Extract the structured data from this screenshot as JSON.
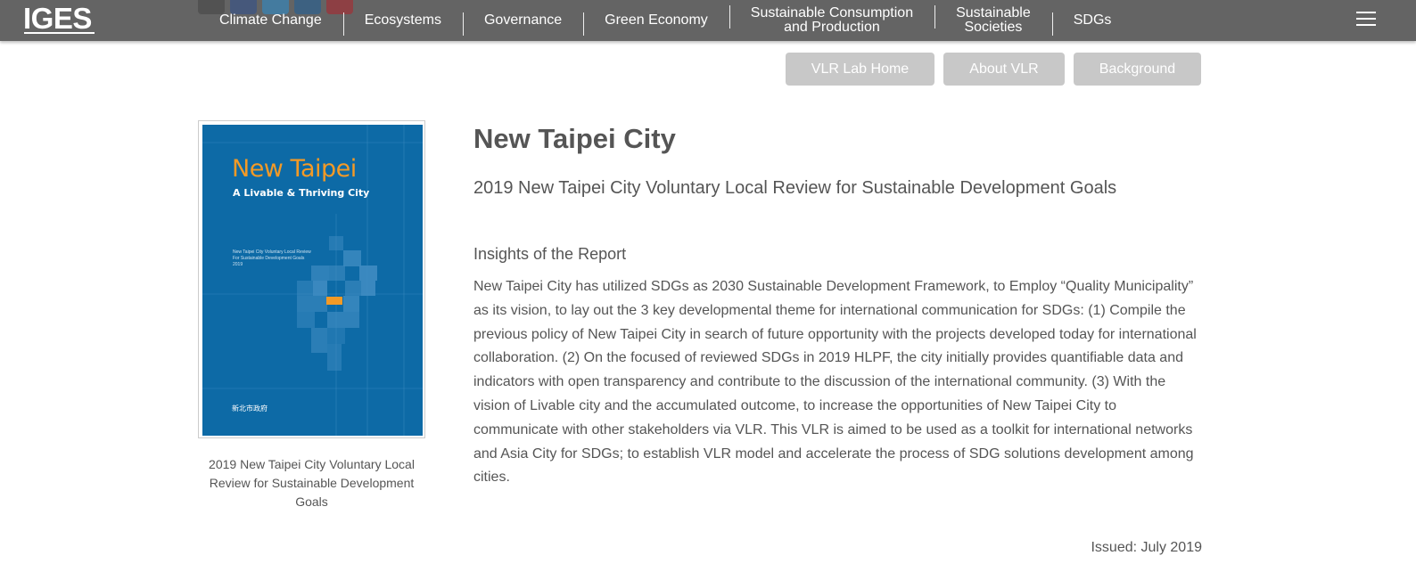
{
  "header": {
    "logo": "IGES",
    "nav": [
      {
        "label_line1": "Climate Change",
        "label_line2": ""
      },
      {
        "label_line1": "Ecosystems",
        "label_line2": ""
      },
      {
        "label_line1": "Governance",
        "label_line2": ""
      },
      {
        "label_line1": "Green Economy",
        "label_line2": ""
      },
      {
        "label_line1": "Sustainable Consumption",
        "label_line2": "and Production"
      },
      {
        "label_line1": "Sustainable",
        "label_line2": "Societies"
      },
      {
        "label_line1": "SDGs",
        "label_line2": ""
      }
    ],
    "menu_icon": "hamburger-icon",
    "social_icons": [
      "email-icon",
      "facebook-icon",
      "twitter-icon",
      "linkedin-icon",
      "pinterest-icon"
    ]
  },
  "subnav": {
    "vlr_home": "VLR Lab Home",
    "about_vlr": "About VLR",
    "background": "Background"
  },
  "cover": {
    "title": "New Taipei",
    "subtitle": "A Livable & Thriving City",
    "small_text": "New Taipei City Voluntary Local Review For Sustainable Development Goals 2019",
    "caption": "2019 New Taipei City Voluntary Local Review for Sustainable Development Goals"
  },
  "main": {
    "title": "New Taipei City",
    "subtitle": "2019 New Taipei City Voluntary Local Review for Sustainable Development Goals",
    "section_heading": "Insights of the Report",
    "body": "New Taipei City has utilized SDGs as 2030 Sustainable Development Framework, to Employ “Quality Municipality” as its vision, to lay out the 3 key developmental theme for international communication for SDGs: (1) Compile the previous policy of New Taipei City in search of future opportunity with the projects developed today for international collaboration. (2) On the focused of reviewed SDGs in 2019 HLPF, the city initially provides quantifiable data and indicators with open transparency and contribute to the discussion of the international community. (3) With the vision of Livable city and the accumulated outcome, to increase the opportunities of New Taipei City to communicate with other stakeholders via VLR. This VLR is aimed to be used as a toolkit for international networks and Asia City for SDGs; to establish VLR model and accelerate the process of SDG solutions development among cities.",
    "issued": "Issued: July 2019"
  },
  "colors": {
    "topbar": "#646464",
    "subnav_button": "#c8c8c8",
    "cover_blue": "#0d6aa6",
    "cover_orange": "#f39a26",
    "text": "#555555"
  }
}
